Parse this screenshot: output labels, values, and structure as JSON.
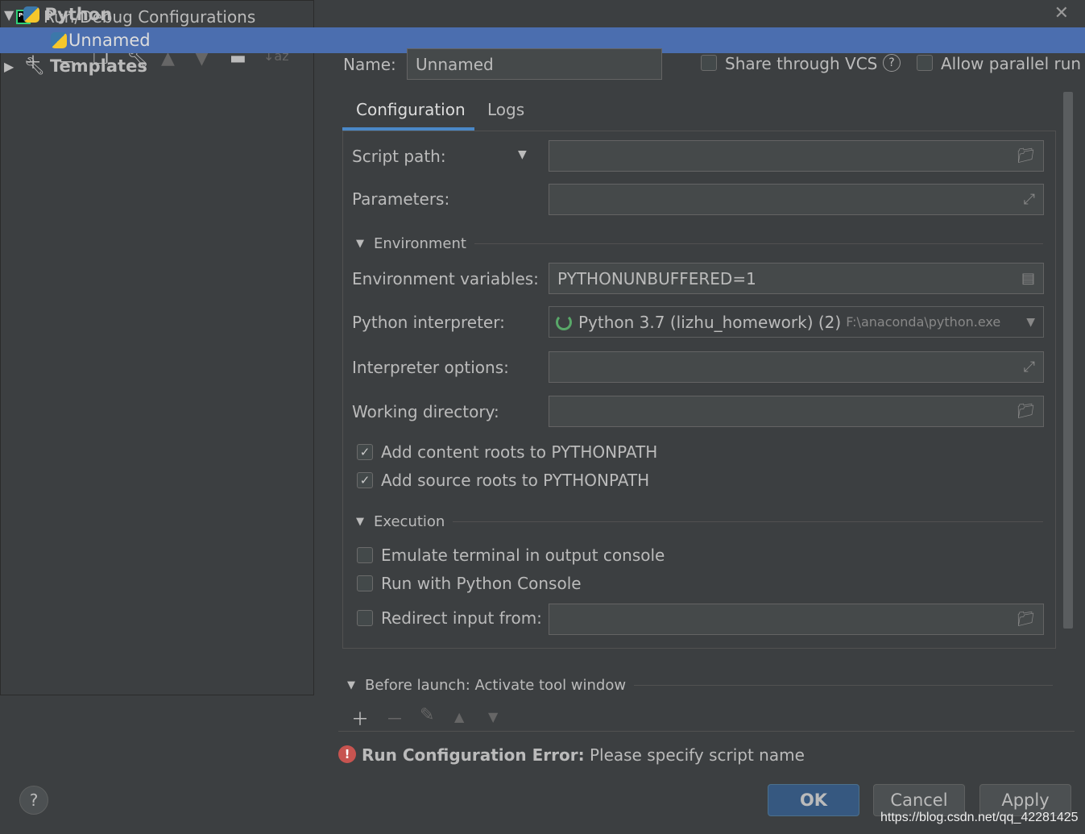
{
  "window": {
    "title": "Run/Debug Configurations",
    "logo_text": "PC"
  },
  "toolbar": {
    "icons": [
      "plus-icon",
      "minus-icon",
      "copy-icon",
      "wrench-icon",
      "arrow-up-icon",
      "arrow-down-icon",
      "new-folder-icon",
      "sort-az-icon"
    ]
  },
  "tree": {
    "items": [
      {
        "label": "Python"
      },
      {
        "label": "Unnamed"
      },
      {
        "label": "Templates"
      }
    ]
  },
  "header": {
    "name_label": "Name:",
    "name_value": "Unnamed",
    "share_vcs": "Share through VCS",
    "allow_parallel": "Allow parallel run"
  },
  "tabs": [
    {
      "label": "Configuration",
      "active": true
    },
    {
      "label": "Logs"
    }
  ],
  "config": {
    "script_path_label": "Script path:",
    "script_path_value": "",
    "parameters_label": "Parameters:",
    "parameters_value": "",
    "environment_section": "Environment",
    "env_vars_label": "Environment variables:",
    "env_vars_value": "PYTHONUNBUFFERED=1",
    "interpreter_label": "Python interpreter:",
    "interpreter_value": "Python 3.7 (lizhu_homework) (2)",
    "interpreter_path": "F:\\anaconda\\python.exe",
    "interp_options_label": "Interpreter options:",
    "interp_options_value": "",
    "working_dir_label": "Working directory:",
    "working_dir_value": "",
    "add_content_roots": "Add content roots to PYTHONPATH",
    "add_content_roots_checked": true,
    "add_source_roots": "Add source roots to PYTHONPATH",
    "add_source_roots_checked": true,
    "execution_section": "Execution",
    "emulate_terminal": "Emulate terminal in output console",
    "emulate_terminal_checked": false,
    "run_python_console": "Run with Python Console",
    "run_python_console_checked": false,
    "redirect_input": "Redirect input from:",
    "redirect_input_checked": false
  },
  "before_launch": {
    "title": "Before launch: Activate tool window"
  },
  "error": {
    "title": "Run Configuration Error:",
    "message": "Please specify script name",
    "color": "#c75450"
  },
  "buttons": {
    "ok": "OK",
    "cancel": "Cancel",
    "apply": "Apply",
    "help": "?"
  },
  "watermark": "https://blog.csdn.net/qq_42281425"
}
